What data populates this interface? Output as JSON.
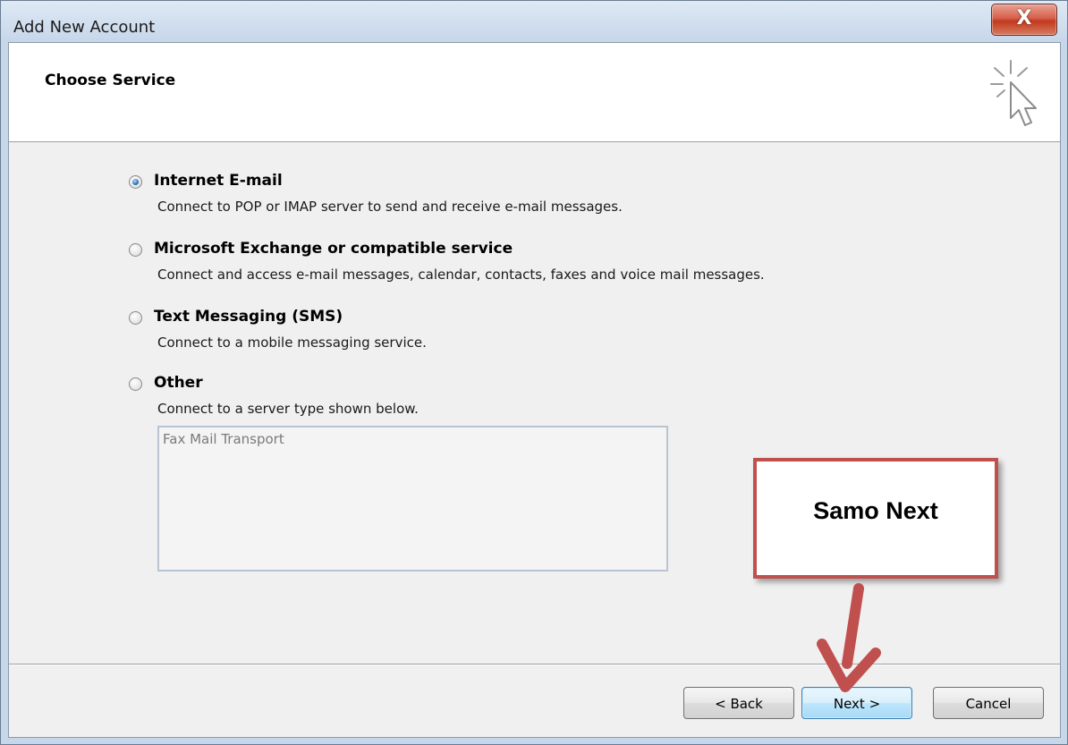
{
  "window": {
    "title": "Add New Account",
    "close_label": "X"
  },
  "header": {
    "title": "Choose Service",
    "icon": "cursor-sparkle-icon"
  },
  "options": [
    {
      "label": "Internet E-mail",
      "description": "Connect to POP or IMAP server to send and receive e-mail messages.",
      "selected": true
    },
    {
      "label": "Microsoft Exchange or compatible service",
      "description": "Connect and access e-mail messages, calendar, contacts, faxes and voice mail messages.",
      "selected": false
    },
    {
      "label": "Text Messaging (SMS)",
      "description": "Connect to a mobile messaging service.",
      "selected": false
    },
    {
      "label": "Other",
      "description": "Connect to a server type shown below.",
      "selected": false
    }
  ],
  "other_list": {
    "items": [
      "Fax Mail Transport"
    ]
  },
  "buttons": {
    "back": "< Back",
    "next": "Next >",
    "cancel": "Cancel"
  },
  "annotation": {
    "callout_text": "Samo Next",
    "color": "#c0504d"
  }
}
